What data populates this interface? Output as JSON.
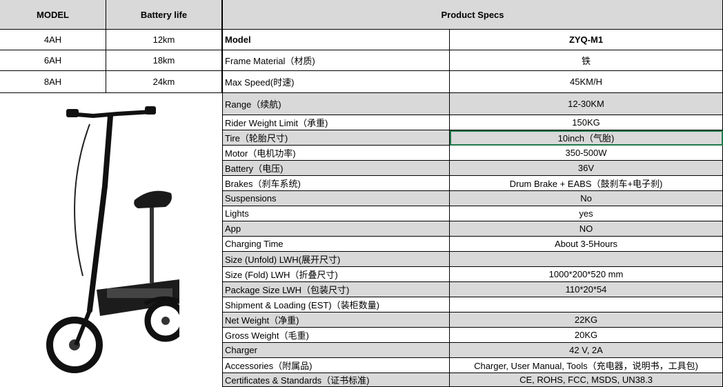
{
  "battery_table": {
    "headers": [
      "MODEL",
      "Battery life"
    ],
    "rows": [
      [
        "4AH",
        "12km"
      ],
      [
        "6AH",
        "18km"
      ],
      [
        "8AH",
        "24km"
      ]
    ]
  },
  "specs": {
    "header": "Product Specs",
    "rows": [
      [
        "Model",
        "ZYQ-M1"
      ],
      [
        "Frame Material（材质)",
        "铁"
      ],
      [
        "Max Speed(时速)",
        "45KM/H"
      ],
      [
        "Range（续航)",
        "12-30KM"
      ],
      [
        "Rider Weight Limit（承重)",
        "150KG"
      ],
      [
        "Tire（轮胎尺寸)",
        "10inch（气胎)"
      ],
      [
        "Motor（电机功率)",
        "350-500W"
      ],
      [
        "Battery（电压)",
        "36V"
      ],
      [
        "Brakes（刹车系统)",
        "Drum Brake + EABS（鼓刹车+电子刹)"
      ],
      [
        "Suspensions",
        "No"
      ],
      [
        "Lights",
        "yes"
      ],
      [
        "App",
        "NO"
      ],
      [
        "Charging Time",
        "About 3-5Hours"
      ],
      [
        "Size (Unfold) LWH(展开尺寸)",
        ""
      ],
      [
        "Size (Fold) LWH（折叠尺寸)",
        "1000*200*520 mm"
      ],
      [
        "Package Size LWH（包装尺寸)",
        "110*20*54"
      ],
      [
        "Shipment & Loading (EST)（装柜数量)",
        ""
      ],
      [
        "Net Weight（净重)",
        "22KG"
      ],
      [
        "Gross Weight（毛重)",
        "20KG"
      ],
      [
        "Charger",
        "42 V, 2A"
      ],
      [
        "Accessories（附属品)",
        "Charger, User Manual, Tools（充电器，说明书，工具包)"
      ],
      [
        "Certificates & Standards（证书标准)",
        "CE, ROHS, FCC, MSDS, UN38.3"
      ]
    ]
  },
  "colors": {
    "header_gray": "#d9d9d9",
    "row_gray": "#d9d9d9",
    "selection": "#1f7a4a"
  }
}
